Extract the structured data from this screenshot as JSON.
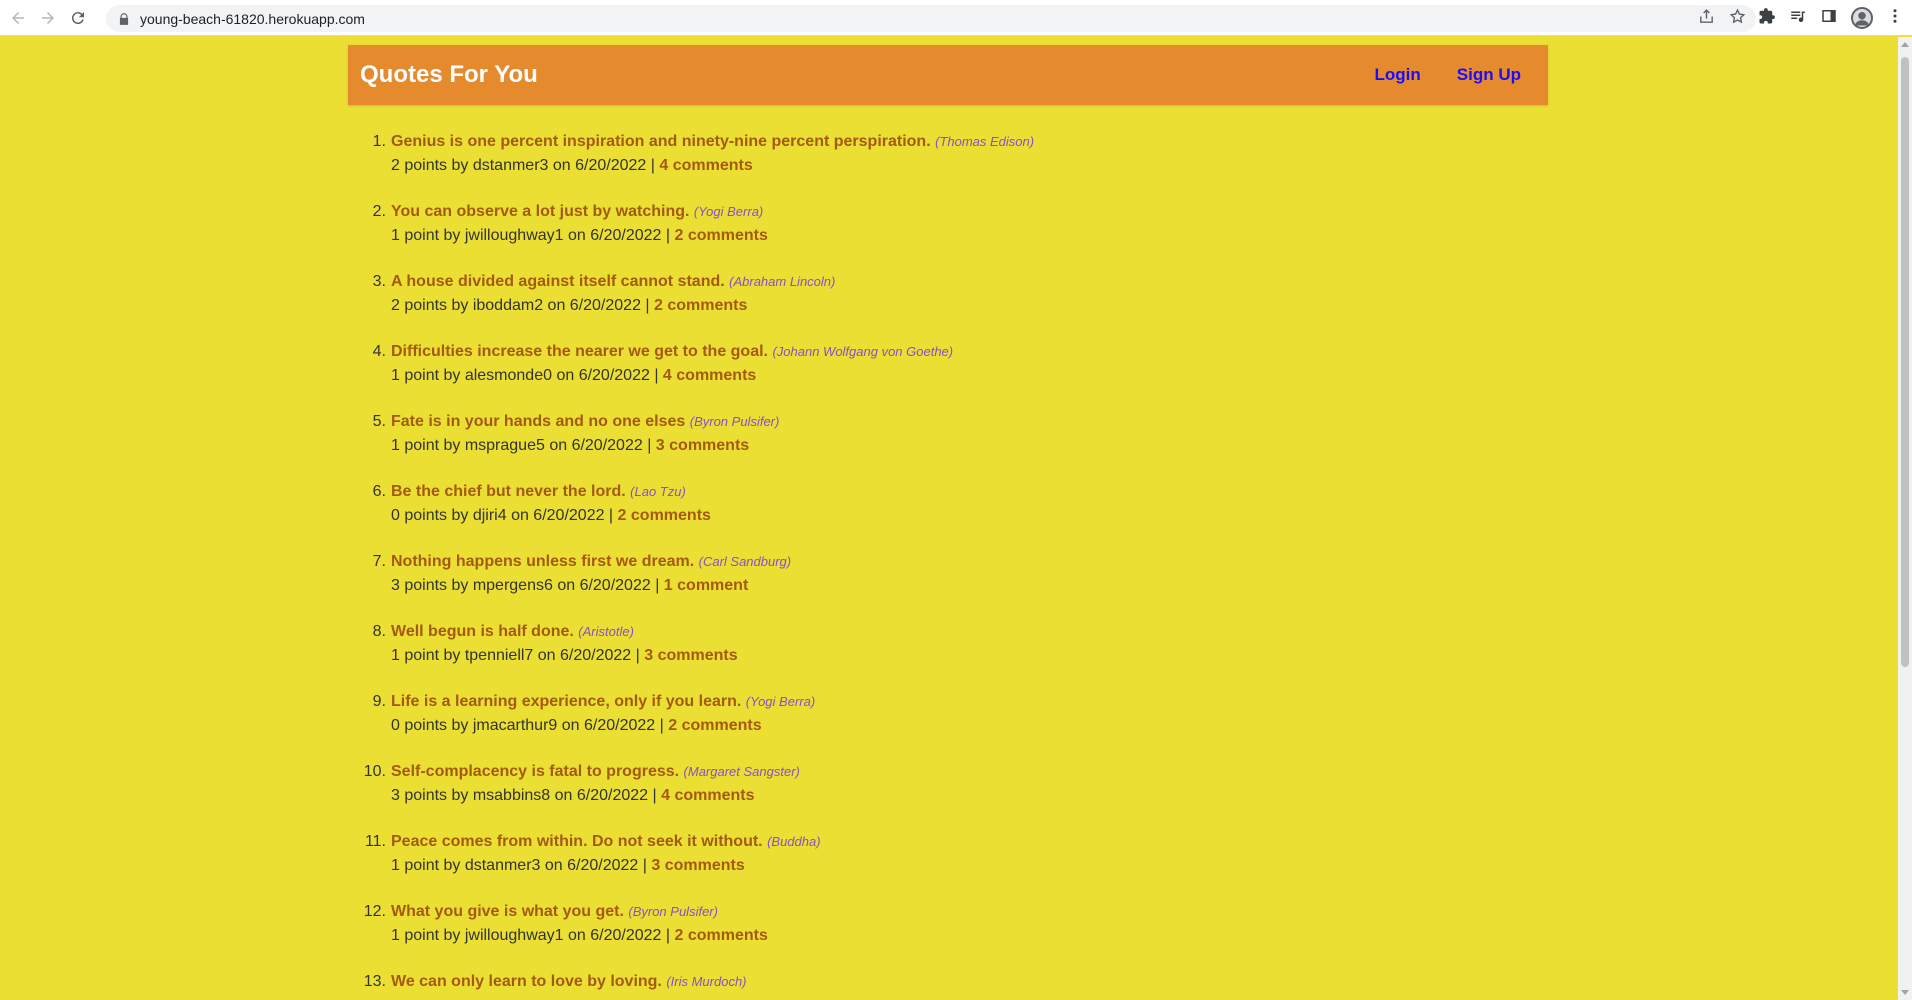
{
  "browser": {
    "url": "young-beach-61820.herokuapp.com"
  },
  "header": {
    "title": "Quotes For You",
    "login_label": "Login",
    "signup_label": "Sign Up"
  },
  "quotes": [
    {
      "num": "1.",
      "text": "Genius is one percent inspiration and ninety-nine percent perspiration.",
      "author": "(Thomas Edison)",
      "meta": "2 points by dstanmer3 on 6/20/2022 |",
      "comments": "4 comments"
    },
    {
      "num": "2.",
      "text": "You can observe a lot just by watching.",
      "author": "(Yogi Berra)",
      "meta": "1 point by jwilloughway1 on 6/20/2022 |",
      "comments": "2 comments"
    },
    {
      "num": "3.",
      "text": "A house divided against itself cannot stand.",
      "author": "(Abraham Lincoln)",
      "meta": "2 points by iboddam2 on 6/20/2022 |",
      "comments": "2 comments"
    },
    {
      "num": "4.",
      "text": "Difficulties increase the nearer we get to the goal.",
      "author": "(Johann Wolfgang von Goethe)",
      "meta": "1 point by alesmonde0 on 6/20/2022 |",
      "comments": "4 comments"
    },
    {
      "num": "5.",
      "text": "Fate is in your hands and no one elses",
      "author": "(Byron Pulsifer)",
      "meta": "1 point by msprague5 on 6/20/2022 |",
      "comments": "3 comments"
    },
    {
      "num": "6.",
      "text": "Be the chief but never the lord.",
      "author": "(Lao Tzu)",
      "meta": "0 points by djiri4 on 6/20/2022 |",
      "comments": "2 comments"
    },
    {
      "num": "7.",
      "text": "Nothing happens unless first we dream.",
      "author": "(Carl Sandburg)",
      "meta": "3 points by mpergens6 on 6/20/2022 |",
      "comments": "1 comment"
    },
    {
      "num": "8.",
      "text": "Well begun is half done.",
      "author": "(Aristotle)",
      "meta": "1 point by tpenniell7 on 6/20/2022 |",
      "comments": "3 comments"
    },
    {
      "num": "9.",
      "text": "Life is a learning experience, only if you learn.",
      "author": "(Yogi Berra)",
      "meta": "0 points by jmacarthur9 on 6/20/2022 |",
      "comments": "2 comments"
    },
    {
      "num": "10.",
      "text": "Self-complacency is fatal to progress.",
      "author": "(Margaret Sangster)",
      "meta": "3 points by msabbins8 on 6/20/2022 |",
      "comments": "4 comments"
    },
    {
      "num": "11.",
      "text": "Peace comes from within. Do not seek it without.",
      "author": "(Buddha)",
      "meta": "1 point by dstanmer3 on 6/20/2022 |",
      "comments": "3 comments"
    },
    {
      "num": "12.",
      "text": "What you give is what you get.",
      "author": "(Byron Pulsifer)",
      "meta": "1 point by jwilloughway1 on 6/20/2022 |",
      "comments": "2 comments"
    },
    {
      "num": "13.",
      "text": "We can only learn to love by loving.",
      "author": "(Iris Murdoch)",
      "meta": "",
      "comments": ""
    }
  ]
}
